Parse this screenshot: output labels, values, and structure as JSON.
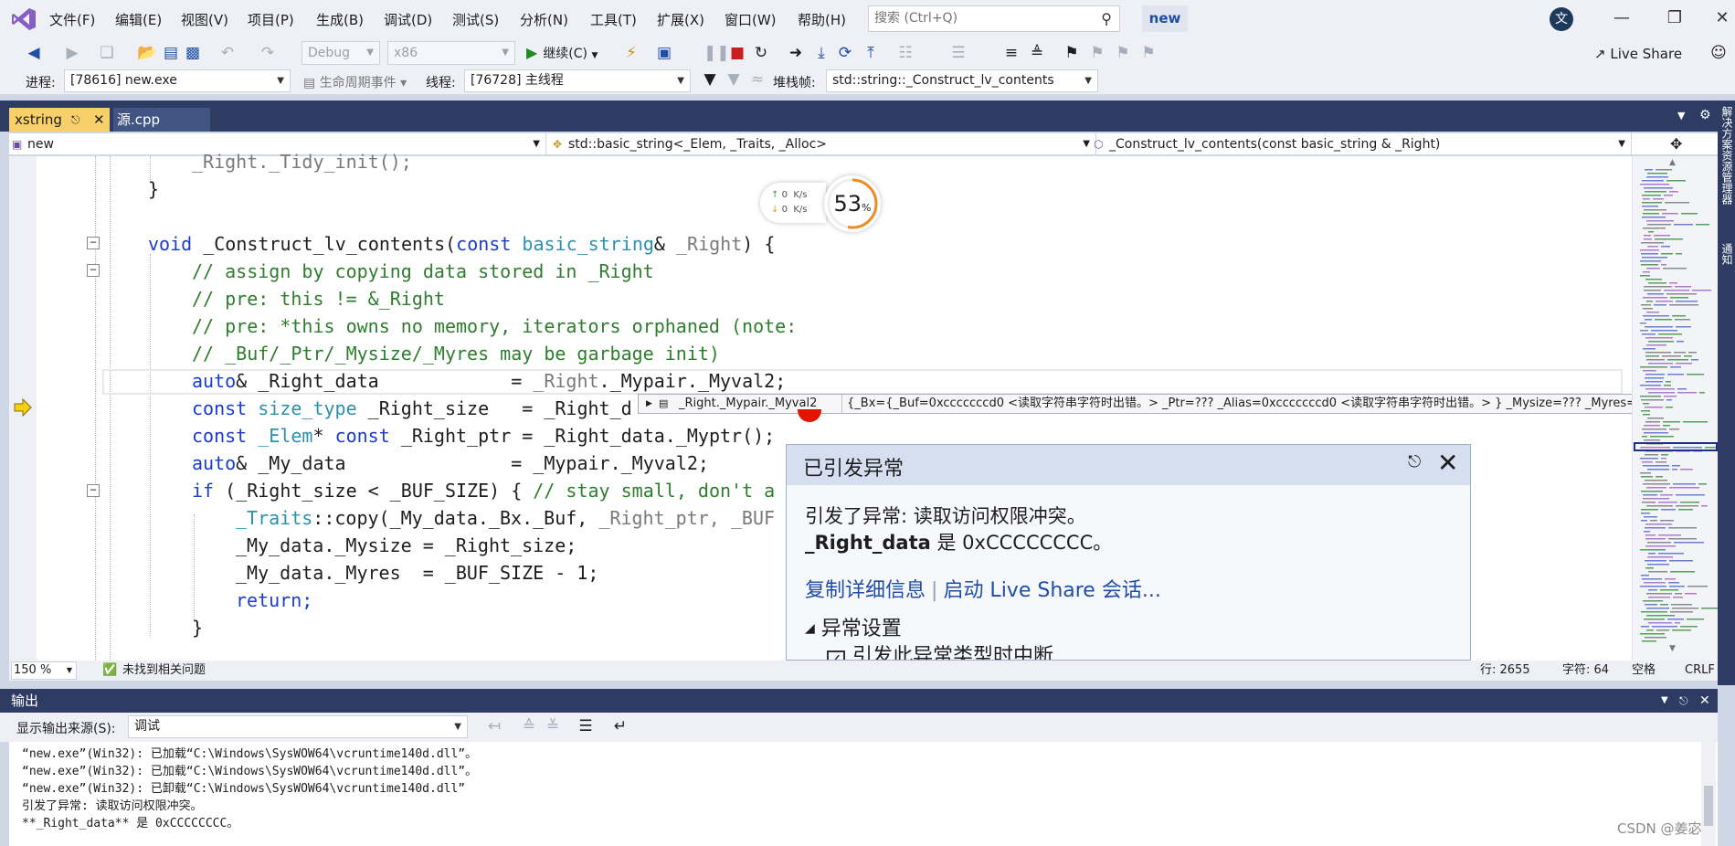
{
  "menu": [
    "文件(F)",
    "编辑(E)",
    "视图(V)",
    "项目(P)",
    "生成(B)",
    "调试(D)",
    "测试(S)",
    "分析(N)",
    "工具(T)",
    "扩展(X)",
    "窗口(W)",
    "帮助(H)"
  ],
  "search": {
    "placeholder": "搜索 (Ctrl+Q)"
  },
  "solution_name": "new",
  "user_initial": "文",
  "toolbar": {
    "config": "Debug",
    "platform": "x86",
    "continue": "继续(C)",
    "live_share": "Live Share"
  },
  "debug_bar": {
    "process_label": "进程:",
    "process_value": "[78616] new.exe",
    "lifecycle": "生命周期事件",
    "thread_label": "线程:",
    "thread_value": "[76728] 主线程",
    "stack_label": "堆栈帧:",
    "stack_value": "std::string::_Construct_lv_contents"
  },
  "tabs": {
    "active": "xstring",
    "other": "源.cpp"
  },
  "side_panel": {
    "top": "解决方案资源管理器",
    "bottom": "通知"
  },
  "navbar": {
    "project": "new",
    "class": "std::basic_string<_Elem, _Traits, _Alloc>",
    "member": "_Construct_lv_contents(const basic_string & _Right)"
  },
  "code": {
    "l1": "_Right._Tidy_init();",
    "l2": "}",
    "l3a": "void",
    "l3b": " _Construct_lv_contents(",
    "l3c": "const",
    "l3d": " basic_string",
    "l3e": "& ",
    "l3f": "_Right",
    "l3g": ") {",
    "l4": "// assign by copying data stored in _Right",
    "l5": "// pre: this != &_Right",
    "l6": "// pre: *this owns no memory, iterators orphaned (note:",
    "l7": "// _Buf/_Ptr/_Mysize/_Myres may be garbage init)",
    "l8a": "auto",
    "l8b": "& _Right_data            = ",
    "l8c": "_Right",
    "l8d": "._Mypair._Myval2;",
    "l9a": "const",
    "l9b": " size_type",
    "l9c": " _Right_size   = _Right_d",
    "l10a": "const",
    "l10b": " _Elem",
    "l10c": "* ",
    "l10d": "const",
    "l10e": " _Right_ptr = _Right_data._Myptr();",
    "l11a": "auto",
    "l11b": "& _My_data               = _Mypair._Myval2;",
    "l12a": "if",
    "l12b": " (_Right_size < _BUF_SIZE) { ",
    "l12c": "// stay small, don't a",
    "l13a": "_Traits",
    "l13b": "::copy(_My_data._Bx._Buf, ",
    "l13c": "_Right_ptr, _BUF",
    "l14": "_My_data._Mysize = _Right_size;",
    "l15": "_My_data._Myres  = _BUF_SIZE - 1;",
    "l16": "return;",
    "l17": "}"
  },
  "net_widget": {
    "up": "0",
    "down": "0",
    "unit": "K/s",
    "percent": "53",
    "percent_sign": "%",
    "percent_value": 0.53
  },
  "datatip": {
    "name": "_Right._Mypair._Myval2",
    "value": "{_Bx={_Buf=0xcccccccd0 <读取字符串字符时出错。> _Ptr=??? _Alias=0xcccccccd0 <读取字符串字符时出错。> } _Mysize=??? _Myres=??? }"
  },
  "exception": {
    "title": "已引发异常",
    "message1": "引发了异常: 读取访问权限冲突。",
    "var_name": "_Right_data",
    "message2_rest": " 是 0xCCCCCCCC。",
    "link_copy": "复制详细信息",
    "link_share": "启动 Live Share 会话...",
    "settings_header": "异常设置",
    "checkbox_label": "引发此异常类型时中断"
  },
  "status": {
    "zoom": "150 %",
    "issues": "未找到相关问题",
    "line": "行: 2655",
    "char": "字符: 64",
    "spaces": "空格",
    "eol": "CRLF"
  },
  "output": {
    "title": "输出",
    "source_label": "显示输出来源(S):",
    "source_value": "调试",
    "lines": [
      "“new.exe”(Win32): 已加载“C:\\Windows\\SysWOW64\\vcruntime140d.dll”。",
      "“new.exe”(Win32): 已加载“C:\\Windows\\SysWOW64\\vcruntime140d.dll”。",
      "“new.exe”(Win32): 已卸载“C:\\Windows\\SysWOW64\\vcruntime140d.dll”",
      "引发了异常: 读取访问权限冲突。",
      "**_Right_data** 是 0xCCCCCCCC。"
    ]
  },
  "watermark": "CSDN @姜宓",
  "colors": {
    "accent": "#1e4ea8",
    "tab_active": "#f7d06b",
    "panel_header": "#2e3c63",
    "error": "#e51400",
    "gauge": "#f08a24"
  }
}
